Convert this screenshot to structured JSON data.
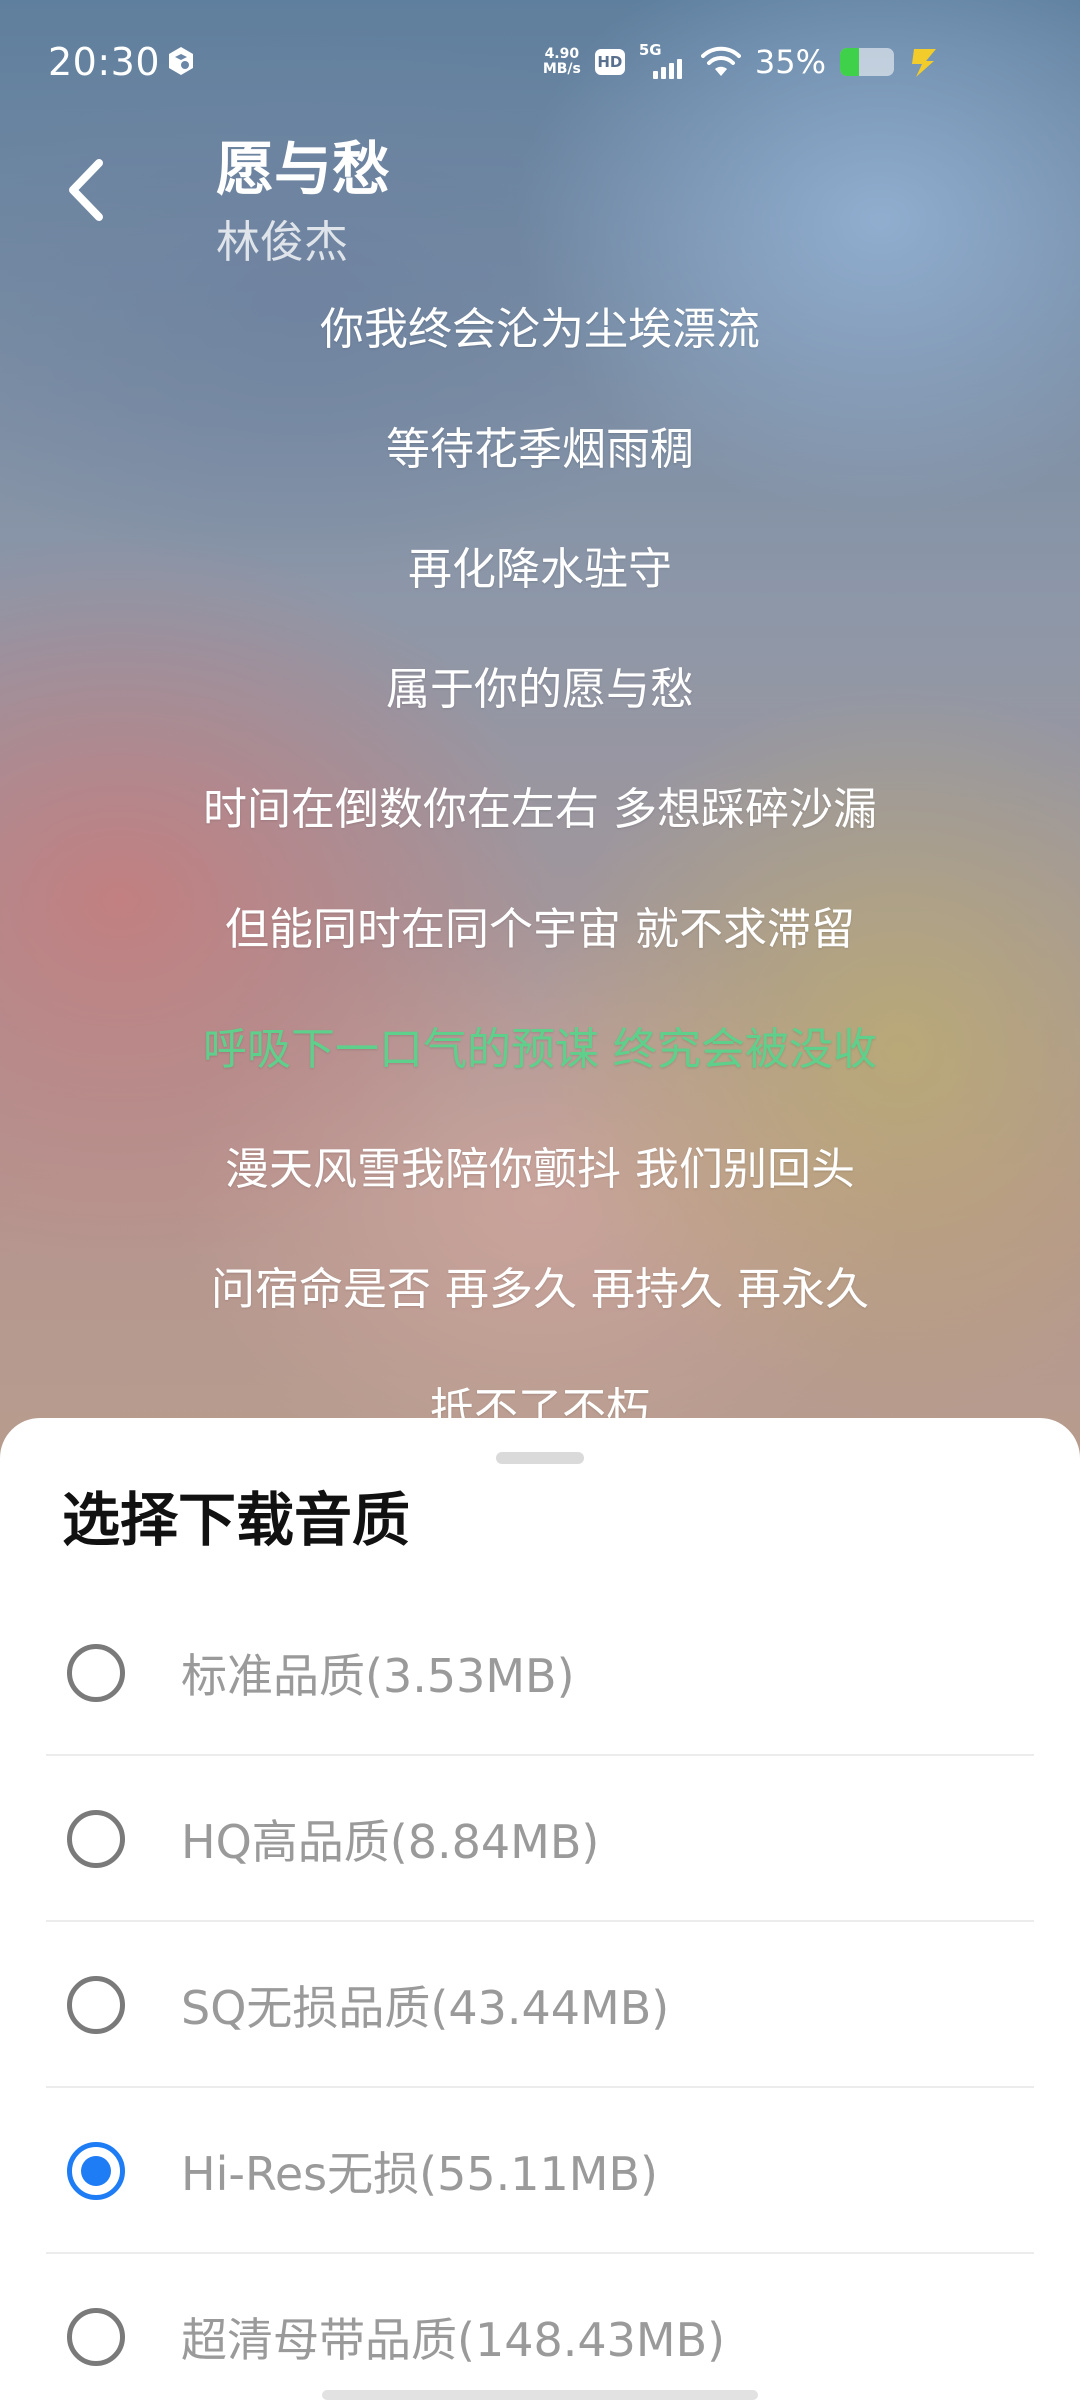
{
  "status_bar": {
    "time": "20:30",
    "net_speed_value": "4.90",
    "net_speed_unit": "MB/s",
    "hd_label": "HD",
    "network_type": "5G",
    "battery_percent": "35%",
    "battery_level": 0.35,
    "battery_color": "#3fd14a",
    "icons": [
      "app-notification-icon",
      "hd-icon",
      "signal-icon",
      "wifi-icon",
      "battery-icon",
      "charging-icon"
    ]
  },
  "header": {
    "title": "愿与愁",
    "artist": "林俊杰",
    "back_icon": "chevron-left-icon"
  },
  "lyrics": {
    "lines": [
      "你我终会沦为尘埃漂流",
      "等待花季烟雨稠",
      "再化降水驻守",
      "属于你的愿与愁",
      "时间在倒数你在左右 多想踩碎沙漏",
      "但能同时在同个宇宙 就不求滞留",
      "呼吸下一口气的预谋 终究会被没收",
      "漫天风雪我陪你颤抖 我们别回头",
      "问宿命是否 再多久 再持久 再永久",
      "抵不了不朽"
    ],
    "active_index": 6,
    "active_color": "#5fd08c"
  },
  "sheet": {
    "title": "选择下载音质",
    "options": [
      {
        "label": "标准品质(3.53MB)",
        "selected": false
      },
      {
        "label": "HQ高品质(8.84MB)",
        "selected": false
      },
      {
        "label": "SQ无损品质(43.44MB)",
        "selected": false
      },
      {
        "label": "Hi-Res无损(55.11MB)",
        "selected": true
      },
      {
        "label": "超清母带品质(148.43MB)",
        "selected": false
      }
    ],
    "accent_color": "#1e7cf5"
  }
}
